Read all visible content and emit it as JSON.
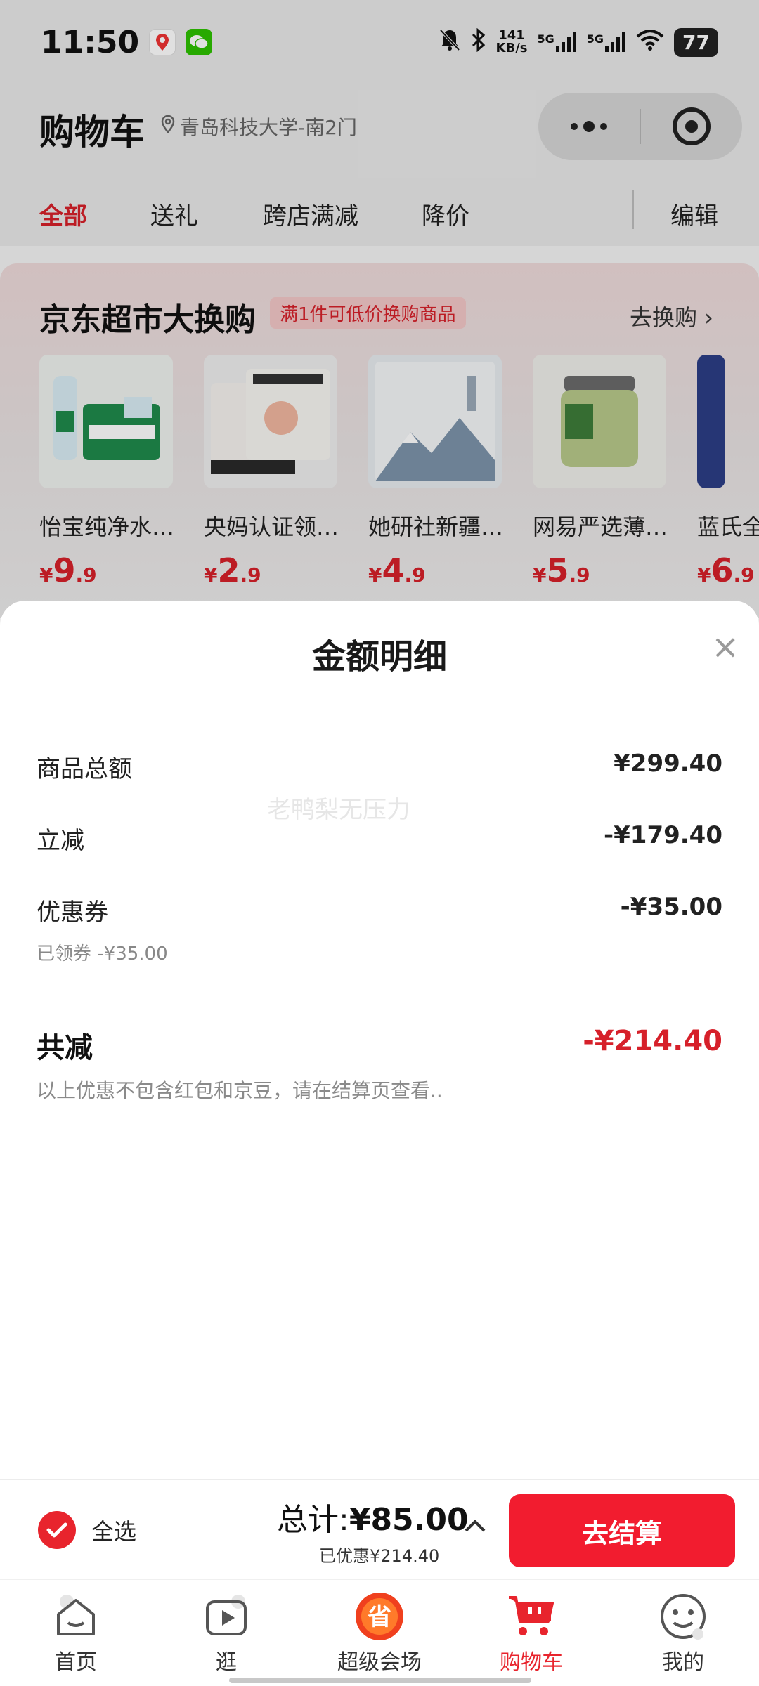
{
  "status_bar": {
    "time": "11:50",
    "net_speed": "141",
    "net_unit": "KB/s",
    "signal_1": "5G",
    "signal_2": "5G",
    "battery": "77"
  },
  "header": {
    "title": "购物车",
    "location": "青岛科技大学-南2门"
  },
  "tabs": [
    {
      "label": "全部",
      "active": true
    },
    {
      "label": "送礼",
      "active": false
    },
    {
      "label": "跨店满减",
      "active": false
    },
    {
      "label": "降价",
      "active": false
    }
  ],
  "edit_label": "编辑",
  "tradein": {
    "title": "京东超市大换购",
    "badge": "满1件可低价换购商品",
    "link": "去换购 ›",
    "products": [
      {
        "name": "怡宝纯净水…",
        "price_int": "9",
        "price_dec": ".9",
        "currency": "¥"
      },
      {
        "name": "央妈认证领…",
        "price_int": "2",
        "price_dec": ".9",
        "currency": "¥"
      },
      {
        "name": "她研社新疆…",
        "price_int": "4",
        "price_dec": ".9",
        "currency": "¥"
      },
      {
        "name": "网易严选薄…",
        "price_int": "5",
        "price_dec": ".9",
        "currency": "¥"
      },
      {
        "name": "蓝氏全",
        "price_int": "6",
        "price_dec": ".9",
        "currency": "¥"
      }
    ]
  },
  "sheet": {
    "title": "金额明细",
    "close": "×",
    "watermark": "老鸭梨无压力",
    "rows": [
      {
        "label": "商品总额",
        "value": "¥299.40"
      },
      {
        "label": "立减",
        "value": "-¥179.40"
      },
      {
        "label": "优惠券",
        "value": "-¥35.00",
        "sub": "已领券 -¥35.00"
      }
    ],
    "total_label": "共减",
    "total_value": "-¥214.40",
    "note": "以上优惠不包含红包和京豆，请在结算页查看.."
  },
  "checkout": {
    "select_all": "全选",
    "sum_label": "总计:",
    "sum_value": "¥85.00",
    "saved": "已优惠¥214.40",
    "button": "去结算"
  },
  "nav": [
    {
      "label": "首页",
      "icon": "home-icon",
      "active": false
    },
    {
      "label": "逛",
      "icon": "video-play-icon",
      "active": false
    },
    {
      "label": "超级会场",
      "icon": "super-venue-icon",
      "active": false
    },
    {
      "label": "购物车",
      "icon": "cart-icon",
      "active": true
    },
    {
      "label": "我的",
      "icon": "profile-smile-icon",
      "active": false
    }
  ],
  "colors": {
    "accent": "#e8242d",
    "checkout_button": "#f21c2f",
    "tab_active": "#d6202a"
  }
}
